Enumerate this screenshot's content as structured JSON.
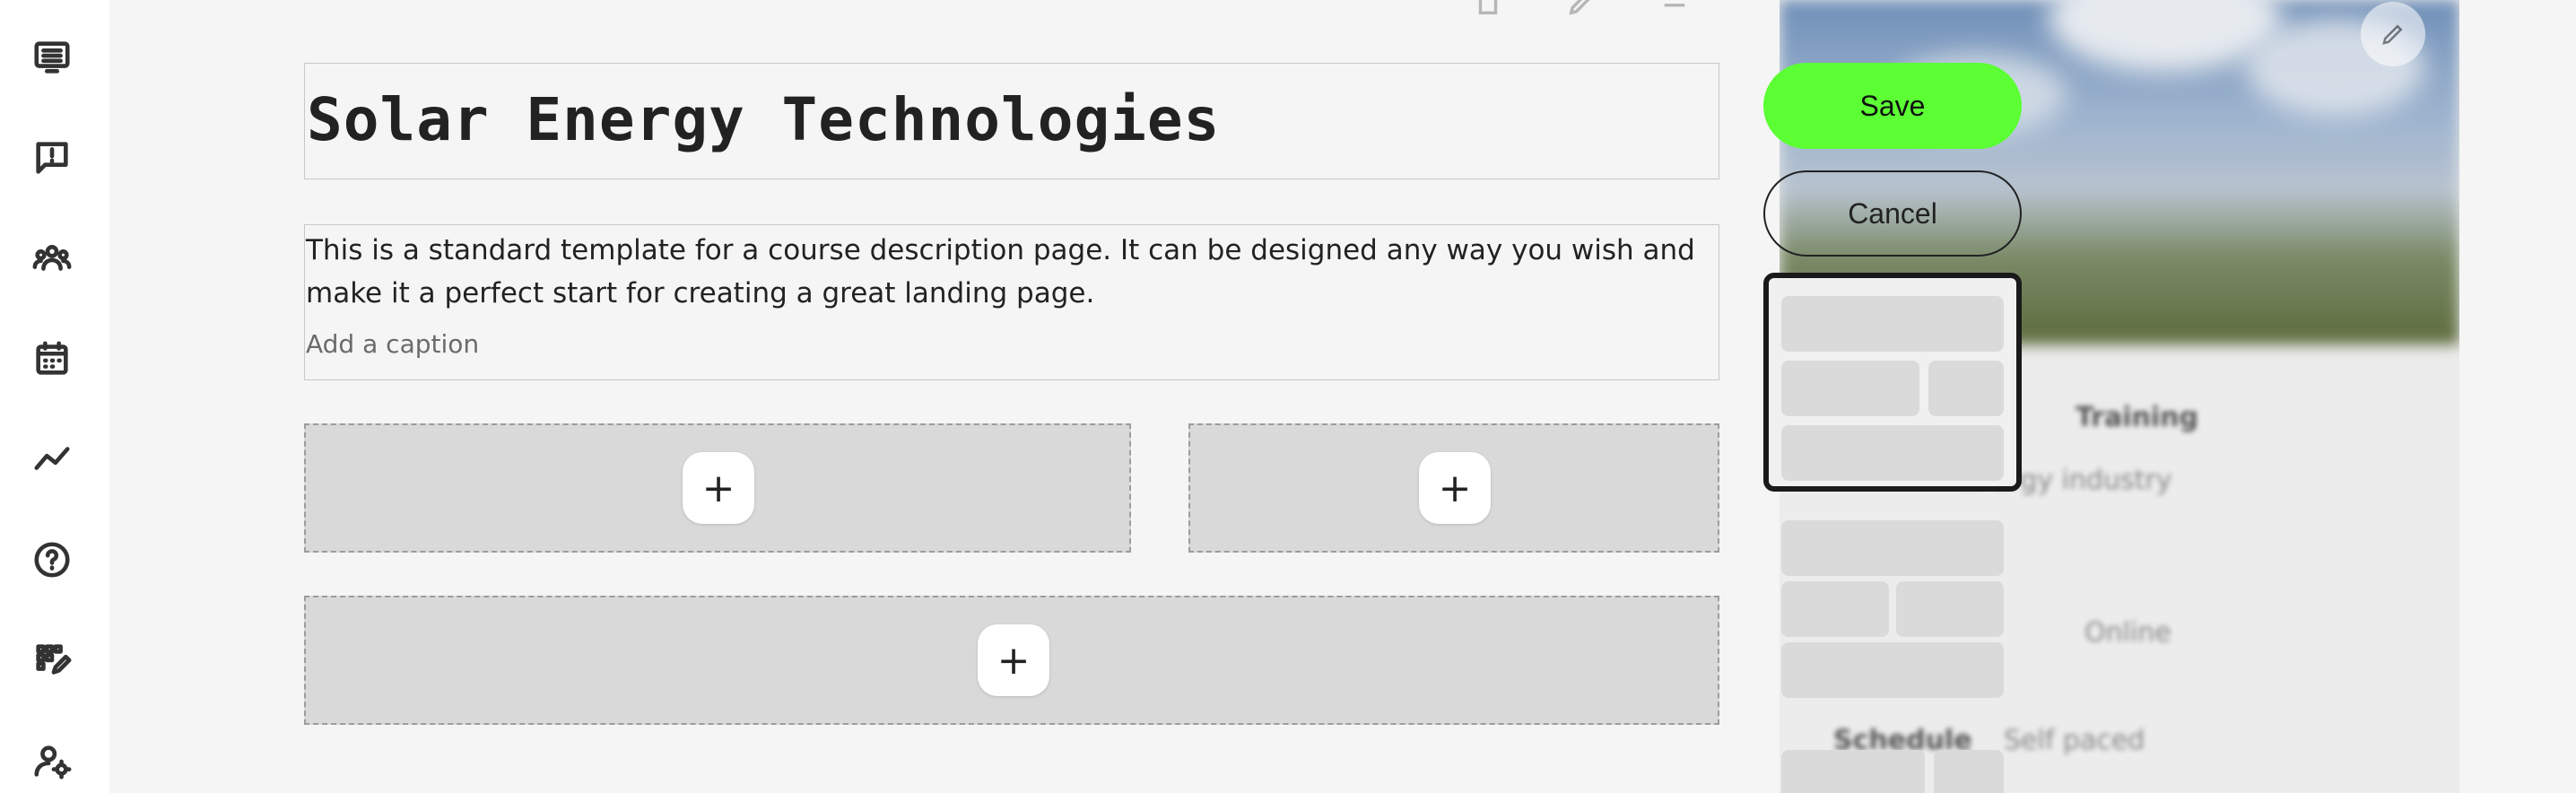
{
  "sidebar": {
    "items": [
      {
        "name": "courses",
        "icon": "list-board-icon"
      },
      {
        "name": "feedback",
        "icon": "message-alert-icon"
      },
      {
        "name": "groups",
        "icon": "group-users-icon"
      },
      {
        "name": "calendar",
        "icon": "calendar-icon"
      },
      {
        "name": "analytics",
        "icon": "trend-line-icon"
      },
      {
        "name": "help",
        "icon": "help-circle-icon"
      },
      {
        "name": "skills",
        "icon": "grid-edit-icon"
      },
      {
        "name": "user-settings",
        "icon": "user-gear-icon"
      }
    ]
  },
  "editor": {
    "title": "Solar Energy Technologies",
    "description": "This is a standard template for a course description page. It can be designed any way you wish and make it a perfect start for creating a great landing page.",
    "caption_placeholder": "Add a caption",
    "add_symbol": "+"
  },
  "actions": {
    "save_label": "Save",
    "cancel_label": "Cancel"
  },
  "preview": {
    "row1_label": "Training",
    "row2_label": "Energy industry",
    "row3_label": "Online",
    "row4_key": "Schedule",
    "row4_value": "Self paced"
  },
  "colors": {
    "accent": "#5bff34",
    "background": "#f5f5f5",
    "slot": "#d9d9d9"
  }
}
